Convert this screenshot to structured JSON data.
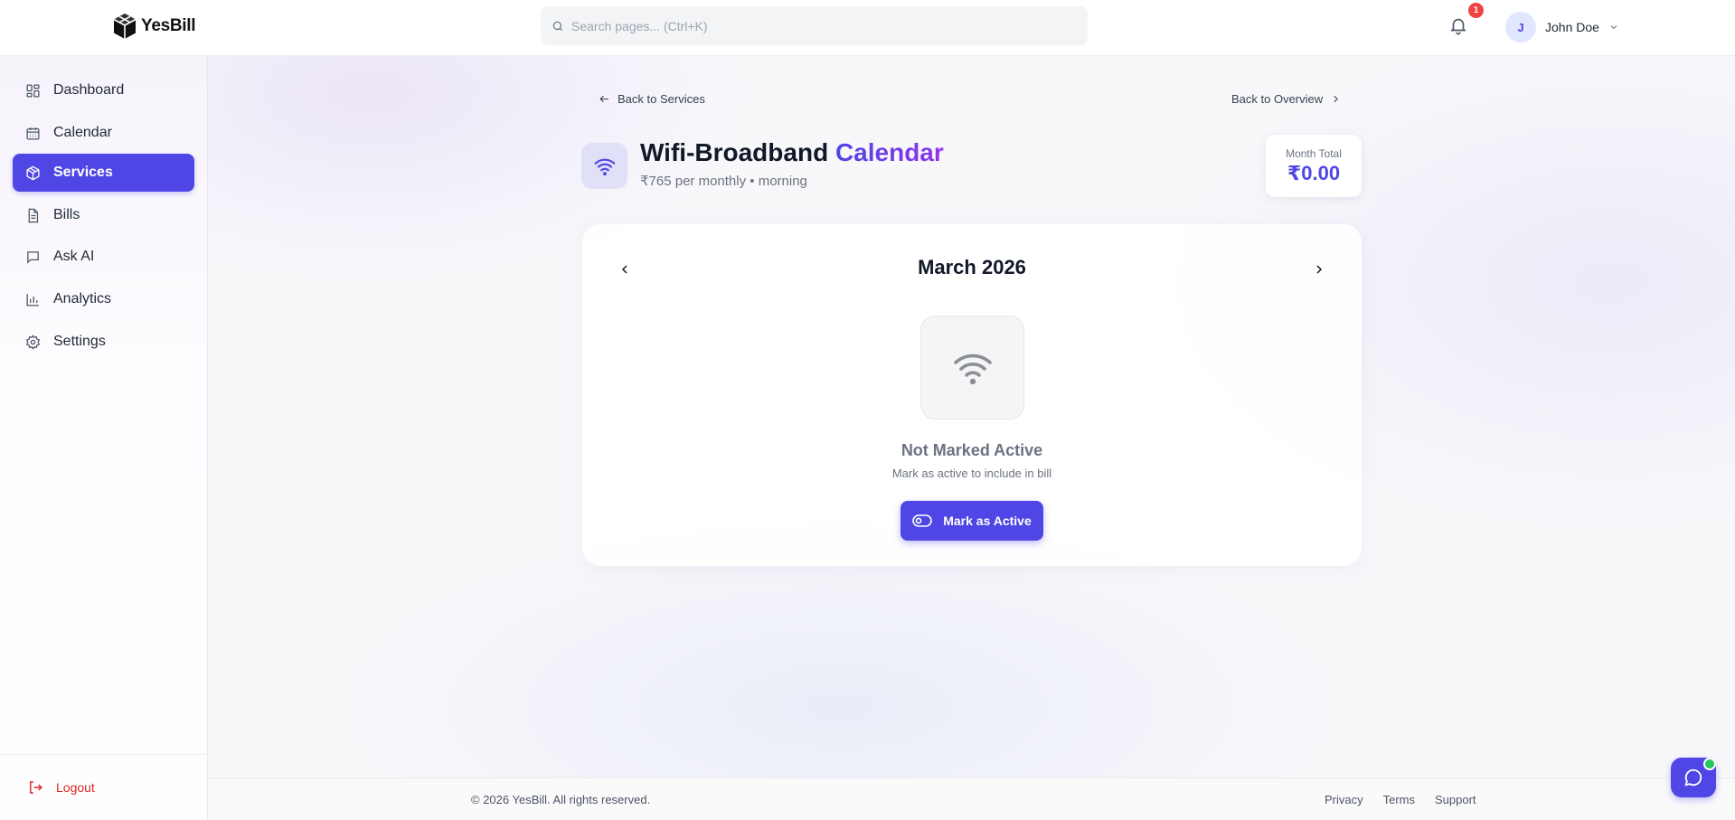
{
  "header": {
    "brand": "YesBill",
    "search_placeholder": "Search pages... (Ctrl+K)",
    "notification_count": "1",
    "user_initial": "J",
    "user_name": "John Doe"
  },
  "sidebar": {
    "items": [
      {
        "label": "Dashboard",
        "icon": "grid-icon"
      },
      {
        "label": "Calendar",
        "icon": "calendar-icon"
      },
      {
        "label": "Services",
        "icon": "box-icon",
        "active": true
      },
      {
        "label": "Bills",
        "icon": "file-icon"
      },
      {
        "label": "Ask AI",
        "icon": "chat-icon"
      },
      {
        "label": "Analytics",
        "icon": "bar-chart-icon"
      },
      {
        "label": "Settings",
        "icon": "gear-icon"
      }
    ],
    "logout_label": "Logout"
  },
  "main": {
    "back_to_services": "Back to Services",
    "back_to_overview": "Back to Overview",
    "service_name": "Wifi-Broadband",
    "title_accent": "Calendar",
    "service_sub": "₹765 per monthly • morning",
    "month_total_label": "Month Total",
    "month_total_value": "₹0.00",
    "calendar": {
      "month_label": "March 2026",
      "status_title": "Not Marked Active",
      "status_sub": "Mark as active to include in bill",
      "mark_button": "Mark as Active"
    }
  },
  "footer": {
    "copyright": "© 2026 YesBill. All rights reserved.",
    "links": [
      "Privacy",
      "Terms",
      "Support"
    ]
  },
  "colors": {
    "accent": "#4f46e5",
    "accent_purple": "#9333ea",
    "danger": "#dc2626",
    "online": "#22c55e"
  }
}
